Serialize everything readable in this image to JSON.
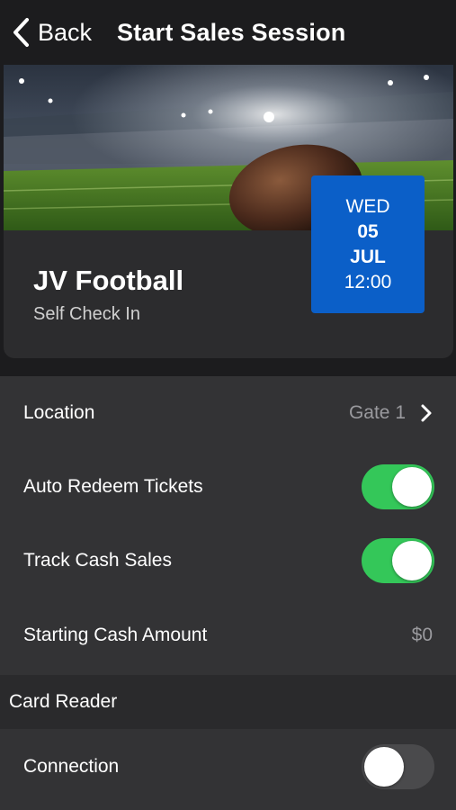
{
  "navbar": {
    "back_label": "Back",
    "title": "Start Sales Session"
  },
  "event": {
    "name": "JV Football",
    "subtitle": "Self Check In",
    "date": {
      "weekday": "WED",
      "day": "05",
      "month": "JUL",
      "time": "12:00"
    }
  },
  "settings": {
    "location": {
      "label": "Location",
      "value": "Gate 1"
    },
    "auto_redeem": {
      "label": "Auto Redeem Tickets",
      "enabled": true
    },
    "track_cash": {
      "label": "Track Cash Sales",
      "enabled": true
    },
    "starting_cash": {
      "label": "Starting Cash Amount",
      "value": "$0"
    }
  },
  "card_reader": {
    "header": "Card Reader",
    "connection": {
      "label": "Connection",
      "enabled": false
    }
  },
  "colors": {
    "background": "#1c1c1e",
    "toggle_on": "#34c759",
    "toggle_off": "#4a4a4c",
    "date_badge": "#0b5fc8"
  }
}
